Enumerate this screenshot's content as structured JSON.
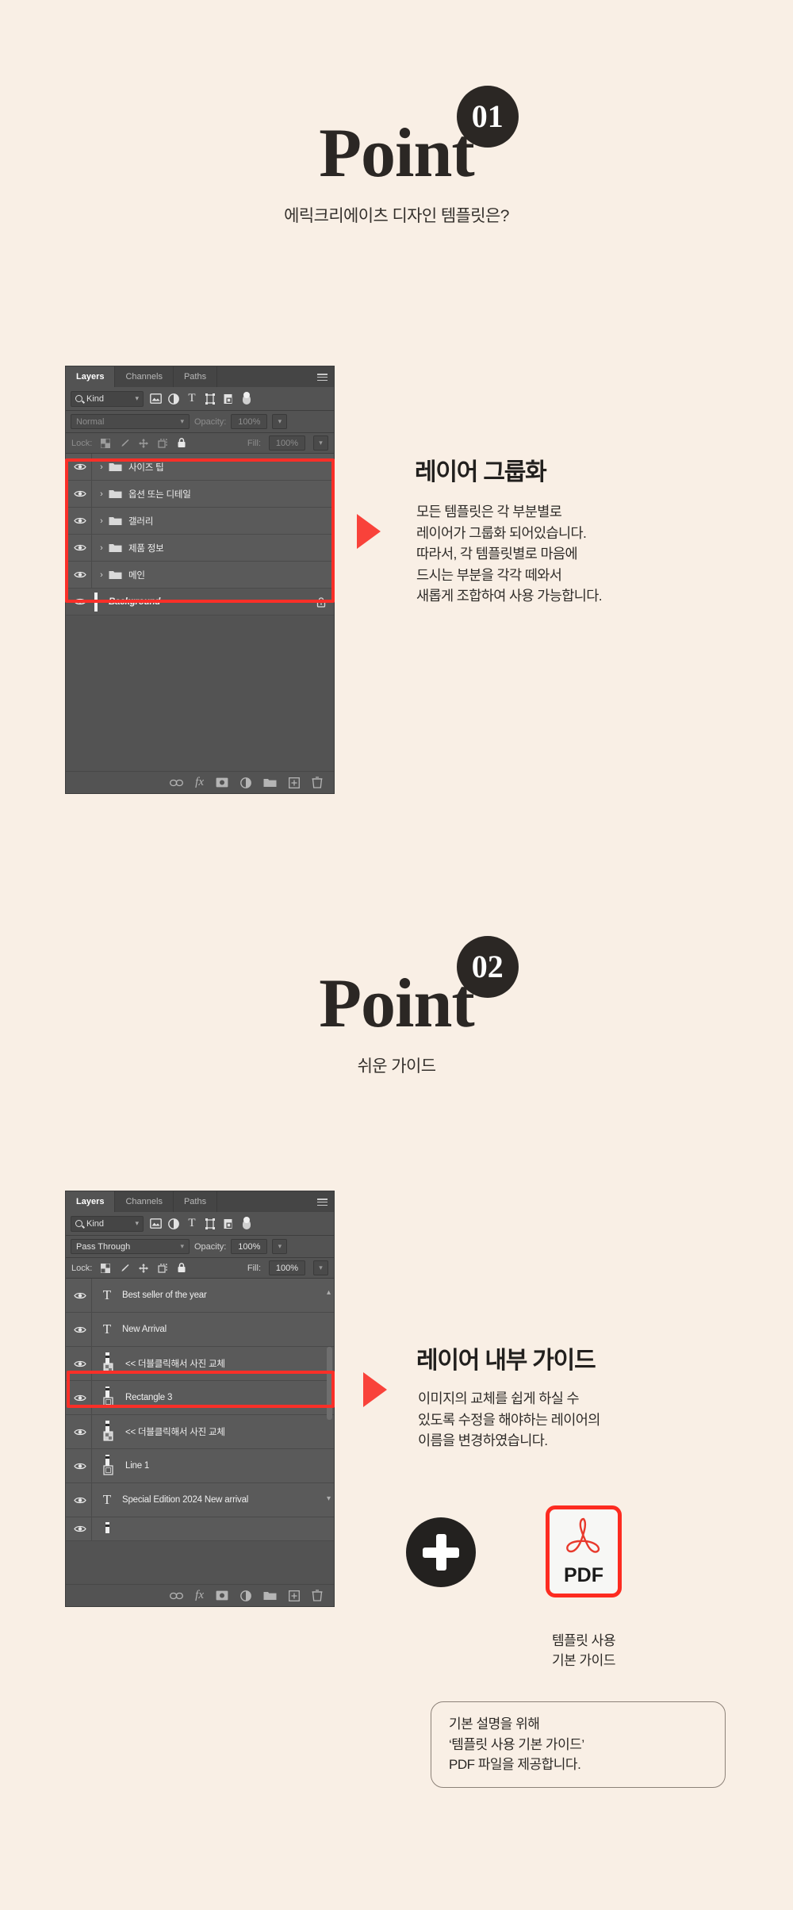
{
  "theme": {
    "background": "#f9efe5",
    "ink": "#22201e",
    "accent_red": "#fa2f28",
    "panel_bg": "#535353"
  },
  "sections": [
    {
      "point_word": "Point",
      "badge": "01",
      "subtitle": "에릭크리에이츠 디자인 템플릿은?",
      "block_title": "레이어 그룹화",
      "block_body": "모든 템플릿은 각 부분별로\n레이어가 그룹화 되어있습니다.\n따라서, 각 템플릿별로 마음에\n드시는 부분을 각각 떼와서\n새롭게 조합하여 사용 가능합니다."
    },
    {
      "point_word": "Point",
      "badge": "02",
      "subtitle": "쉬운 가이드",
      "block_title": "레이어 내부 가이드",
      "block_body": "이미지의 교체를 쉽게 하실 수\n있도록 수정을 해야하는 레이어의\n이름을 변경하였습니다."
    }
  ],
  "panel1": {
    "tabs": [
      "Layers",
      "Channels",
      "Paths"
    ],
    "active_tab": "Layers",
    "filter_label": "Kind",
    "blend_mode": "Normal",
    "opacity_label": "Opacity:",
    "opacity_value": "100%",
    "lock_label": "Lock:",
    "fill_label": "Fill:",
    "fill_value": "100%",
    "layers": [
      {
        "name": "사이즈 팁",
        "type": "folder"
      },
      {
        "name": "옵션 또는 디테일",
        "type": "folder"
      },
      {
        "name": "갤러리",
        "type": "folder"
      },
      {
        "name": "제품 정보",
        "type": "folder"
      },
      {
        "name": "메인",
        "type": "folder"
      }
    ],
    "background_layer": {
      "name": "Background",
      "locked": true
    }
  },
  "panel2": {
    "tabs": [
      "Layers",
      "Channels",
      "Paths"
    ],
    "active_tab": "Layers",
    "filter_label": "Kind",
    "blend_mode": "Pass Through",
    "opacity_label": "Opacity:",
    "opacity_value": "100%",
    "lock_label": "Lock:",
    "fill_label": "Fill:",
    "fill_value": "100%",
    "layers": [
      {
        "name": "Best seller of the year",
        "type": "text"
      },
      {
        "name": "New Arrival",
        "type": "text"
      },
      {
        "name": "<< 더블클릭해서 사진 교체",
        "type": "smart-object",
        "highlighted": true
      },
      {
        "name": "Rectangle 3",
        "type": "shape"
      },
      {
        "name": "<< 더블클릭해서 사진 교체",
        "type": "smart-object"
      },
      {
        "name": "Line 1",
        "type": "shape"
      },
      {
        "name": "Special Edition 2024 New arrival",
        "type": "text"
      }
    ]
  },
  "pdf": {
    "label": "PDF",
    "caption": "템플릿 사용\n기본 가이드",
    "note": "기본 설명을 위해\n‘템플릿 사용 기본 가이드’\nPDF 파일을 제공합니다."
  }
}
